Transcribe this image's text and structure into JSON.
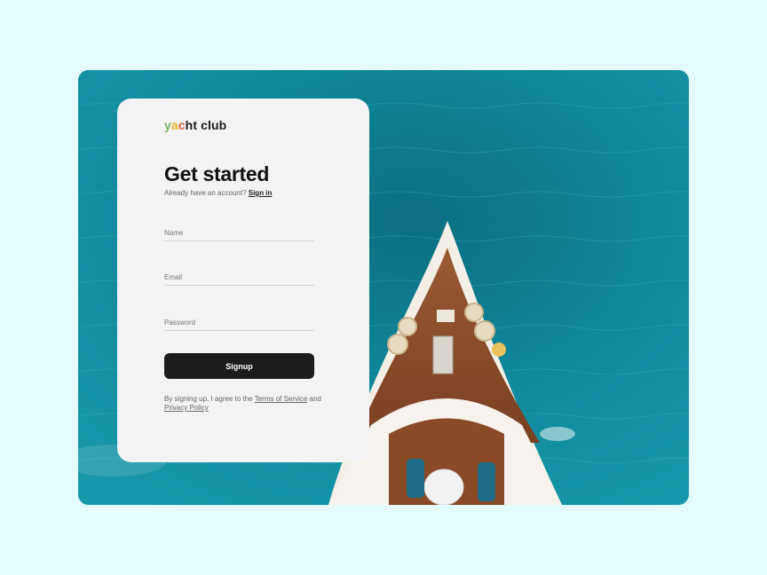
{
  "brand": {
    "logo_parts": [
      "y",
      "a",
      "c",
      "ht club"
    ],
    "logo_colors": [
      "#7bb661",
      "#e6b324",
      "#d95f3a",
      "#1a1a1a"
    ]
  },
  "form": {
    "title": "Get started",
    "subtitle_text": "Already have an account?",
    "signin_link": "Sign in",
    "fields": {
      "name_placeholder": "Name",
      "email_placeholder": "Email",
      "password_placeholder": "Password"
    },
    "submit_label": "Signup",
    "terms_prefix": "By signing up, I agree to the",
    "terms_link": "Terms of Service",
    "terms_and": "and",
    "privacy_link": "Privacy Policy"
  },
  "hero_image": {
    "description_icon": "yacht-aerial-image"
  },
  "colors": {
    "page_background": "#e4fbff",
    "card_background": "#f3f3f3",
    "button_background": "#1c1c1c",
    "sea": "#0f8397"
  }
}
